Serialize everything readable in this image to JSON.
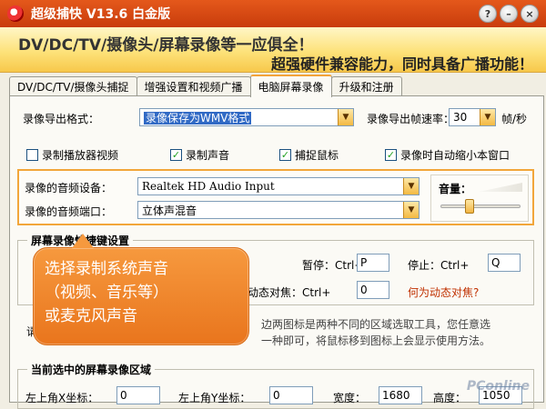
{
  "window": {
    "title": "超级捕快 V13.6 白金版",
    "controls": {
      "help": "?",
      "minimize": "–",
      "close": "×"
    }
  },
  "banner": {
    "line1": "DV/DC/TV/摄像头/屏幕录像等一应俱全！",
    "line2": "超强硬件兼容能力，同时具备广播功能！"
  },
  "tabs": [
    {
      "label": "DV/DC/TV/摄像头捕捉",
      "active": false
    },
    {
      "label": "增强设置和视频广播",
      "active": false
    },
    {
      "label": "电脑屏幕录像",
      "active": true
    },
    {
      "label": "升级和注册",
      "active": false
    }
  ],
  "record": {
    "format_label": "录像导出格式：",
    "format_value": "录像保存为WMV格式",
    "fps_label": "录像导出帧速率：",
    "fps_value": "30",
    "fps_unit": "帧/秒"
  },
  "options": [
    {
      "label": "录制播放器视频",
      "checked": false
    },
    {
      "label": "录制声音",
      "checked": true
    },
    {
      "label": "捕捉鼠标",
      "checked": true
    },
    {
      "label": "录像时自动缩小本窗口",
      "checked": true
    }
  ],
  "audio": {
    "device_label": "录像的音频设备：",
    "device_value": "Realtek HD Audio Input",
    "port_label": "录像的音频端口：",
    "port_value": "立体声混音",
    "volume_label": "音量：",
    "volume_level": 0.35
  },
  "hotkeys": {
    "title": "屏幕录像快捷键设置",
    "pause_label": "暂停：Ctrl+",
    "pause_value": "P",
    "stop_label": "停止：Ctrl+",
    "stop_value": "Q",
    "dyn_label": "动态对焦：Ctrl+",
    "dyn_value": "0",
    "dyn_link": "何为动态对焦?"
  },
  "hint": {
    "prefix": "请",
    "line1": "边两图标是两种不同的区域选取工具，您任意选",
    "line2": "一种即可，将鼠标移到图标上会显示使用方法。"
  },
  "region": {
    "title": "当前选中的屏幕录像区域",
    "left_x_label": "左上角X坐标：",
    "left_x_value": "0",
    "left_y_label": "左上角Y坐标：",
    "left_y_value": "0",
    "width_label": "宽度：",
    "width_value": "1680",
    "height_label": "高度：",
    "height_value": "1050"
  },
  "callout": {
    "line1": "选择录制系统声音",
    "line2": "（视频、音乐等）",
    "line3": "或麦克风声音"
  },
  "watermark": "PConline"
}
